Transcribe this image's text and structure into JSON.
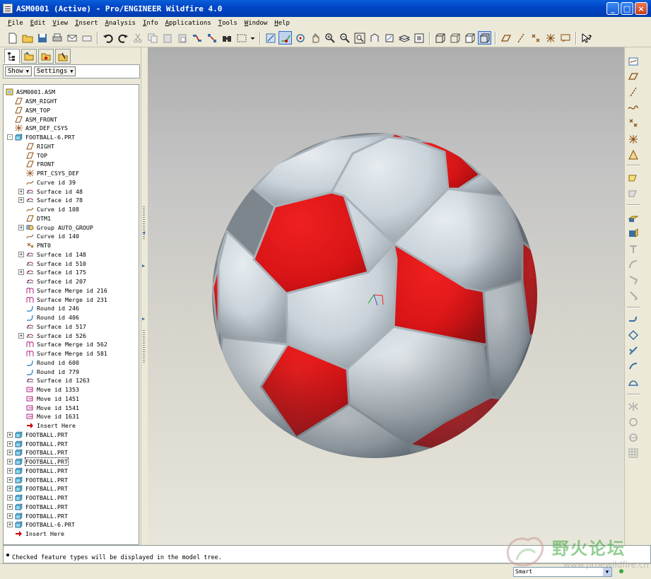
{
  "window": {
    "title": "ASM0001 (Active) - Pro/ENGINEER Wildfire 4.0"
  },
  "menu": [
    {
      "label": "File",
      "u": "F",
      "rest": "ile"
    },
    {
      "label": "Edit",
      "u": "E",
      "rest": "dit"
    },
    {
      "label": "View",
      "u": "V",
      "rest": "iew"
    },
    {
      "label": "Insert",
      "u": "I",
      "rest": "nsert"
    },
    {
      "label": "Analysis",
      "u": "A",
      "rest": "nalysis"
    },
    {
      "label": "Info",
      "u": "I",
      "rest": "nfo"
    },
    {
      "label": "Applications",
      "u": "A",
      "rest": "pplications"
    },
    {
      "label": "Tools",
      "u": "T",
      "rest": "ools"
    },
    {
      "label": "Window",
      "u": "W",
      "rest": "indow"
    },
    {
      "label": "Help",
      "u": "H",
      "rest": "elp"
    }
  ],
  "tree_controls": {
    "show": "Show",
    "settings": "Settings"
  },
  "tree": [
    {
      "label": "ASM0001.ASM",
      "icon": "assembly-icon",
      "level": 0,
      "exp": ""
    },
    {
      "label": "ASM_RIGHT",
      "icon": "datum-plane-icon",
      "level": 1,
      "exp": ""
    },
    {
      "label": "ASM_TOP",
      "icon": "datum-plane-icon",
      "level": 1,
      "exp": ""
    },
    {
      "label": "ASM_FRONT",
      "icon": "datum-plane-icon",
      "level": 1,
      "exp": ""
    },
    {
      "label": "ASM_DEF_CSYS",
      "icon": "csys-icon",
      "level": 1,
      "exp": ""
    },
    {
      "label": "FOOTBALL-6.PRT",
      "icon": "part-icon",
      "level": 1,
      "exp": "-"
    },
    {
      "label": "RIGHT",
      "icon": "datum-plane-icon",
      "level": 2,
      "exp": ""
    },
    {
      "label": "TOP",
      "icon": "datum-plane-icon",
      "level": 2,
      "exp": ""
    },
    {
      "label": "FRONT",
      "icon": "datum-plane-icon",
      "level": 2,
      "exp": ""
    },
    {
      "label": "PRT_CSYS_DEF",
      "icon": "csys-icon",
      "level": 2,
      "exp": ""
    },
    {
      "label": "Curve id 39",
      "icon": "curve-icon",
      "level": 2,
      "exp": ""
    },
    {
      "label": "Surface id 48",
      "icon": "surface-icon",
      "level": 2,
      "exp": "+"
    },
    {
      "label": "Surface id 78",
      "icon": "surface-icon",
      "level": 2,
      "exp": "+"
    },
    {
      "label": "Curve id 108",
      "icon": "curve-icon",
      "level": 2,
      "exp": ""
    },
    {
      "label": "DTM1",
      "icon": "datum-plane-icon",
      "level": 2,
      "exp": ""
    },
    {
      "label": "Group AUTO_GROUP",
      "icon": "group-icon",
      "level": 2,
      "exp": "+"
    },
    {
      "label": "Curve id 140",
      "icon": "curve-icon",
      "level": 2,
      "exp": ""
    },
    {
      "label": "PNT0",
      "icon": "datum-point-icon",
      "level": 2,
      "exp": ""
    },
    {
      "label": "Surface id 148",
      "icon": "surface-icon",
      "level": 2,
      "exp": "+"
    },
    {
      "label": "Surface id 510",
      "icon": "surface-icon",
      "level": 2,
      "exp": ""
    },
    {
      "label": "Surface id 175",
      "icon": "surface-icon",
      "level": 2,
      "exp": "+"
    },
    {
      "label": "Surface id 207",
      "icon": "surface-icon",
      "level": 2,
      "exp": ""
    },
    {
      "label": "Surface Merge id 216",
      "icon": "merge-icon",
      "level": 2,
      "exp": ""
    },
    {
      "label": "Surface Merge id 231",
      "icon": "merge-icon",
      "level": 2,
      "exp": ""
    },
    {
      "label": "Round id 246",
      "icon": "round-icon",
      "level": 2,
      "exp": ""
    },
    {
      "label": "Round id 406",
      "icon": "round-icon",
      "level": 2,
      "exp": ""
    },
    {
      "label": "Surface id 517",
      "icon": "surface-icon",
      "level": 2,
      "exp": ""
    },
    {
      "label": "Surface id 526",
      "icon": "surface-icon",
      "level": 2,
      "exp": "+"
    },
    {
      "label": "Surface Merge id 562",
      "icon": "merge-icon",
      "level": 2,
      "exp": ""
    },
    {
      "label": "Surface Merge id 581",
      "icon": "merge-icon",
      "level": 2,
      "exp": ""
    },
    {
      "label": "Round id 600",
      "icon": "round-icon",
      "level": 2,
      "exp": ""
    },
    {
      "label": "Round id 779",
      "icon": "round-icon",
      "level": 2,
      "exp": ""
    },
    {
      "label": "Surface id 1263",
      "icon": "surface-icon",
      "level": 2,
      "exp": ""
    },
    {
      "label": "Move id 1353",
      "icon": "move-icon",
      "level": 2,
      "exp": ""
    },
    {
      "label": "Move id 1451",
      "icon": "move-icon",
      "level": 2,
      "exp": ""
    },
    {
      "label": "Move id 1541",
      "icon": "move-icon",
      "level": 2,
      "exp": ""
    },
    {
      "label": "Move id 1631",
      "icon": "move-icon",
      "level": 2,
      "exp": ""
    },
    {
      "label": "Insert Here",
      "icon": "insert-here-icon",
      "level": 2,
      "exp": ""
    },
    {
      "label": "FOOTBALL.PRT",
      "icon": "part-icon",
      "level": 1,
      "exp": "+"
    },
    {
      "label": "FOOTBALL.PRT",
      "icon": "part-icon",
      "level": 1,
      "exp": "+"
    },
    {
      "label": "FOOTBALL.PRT",
      "icon": "part-icon",
      "level": 1,
      "exp": "+"
    },
    {
      "label": "FOOTBALL.PRT",
      "icon": "part-icon",
      "level": 1,
      "exp": "+",
      "focused": true
    },
    {
      "label": "FOOTBALL.PRT",
      "icon": "part-icon",
      "level": 1,
      "exp": "+"
    },
    {
      "label": "FOOTBALL.PRT",
      "icon": "part-icon",
      "level": 1,
      "exp": "+"
    },
    {
      "label": "FOOTBALL.PRT",
      "icon": "part-icon",
      "level": 1,
      "exp": "+"
    },
    {
      "label": "FOOTBALL.PRT",
      "icon": "part-icon",
      "level": 1,
      "exp": "+"
    },
    {
      "label": "FOOTBALL.PRT",
      "icon": "part-icon",
      "level": 1,
      "exp": "+"
    },
    {
      "label": "FOOTBALL.PRT",
      "icon": "part-icon",
      "level": 1,
      "exp": "+"
    },
    {
      "label": "FOOTBALL-6.PRT",
      "icon": "part-icon",
      "level": 1,
      "exp": "+"
    },
    {
      "label": "Insert Here",
      "icon": "insert-here-icon",
      "level": 1,
      "exp": ""
    }
  ],
  "message": "Checked feature types will be displayed in the model tree.",
  "filter": {
    "value": "Smart"
  },
  "watermark": {
    "text": "野火论坛",
    "url": "www.proewildfire.cn"
  },
  "colors": {
    "ball_red": "#e0181a",
    "ball_white": "#d3dce2",
    "title_blue": "#0046c8"
  }
}
